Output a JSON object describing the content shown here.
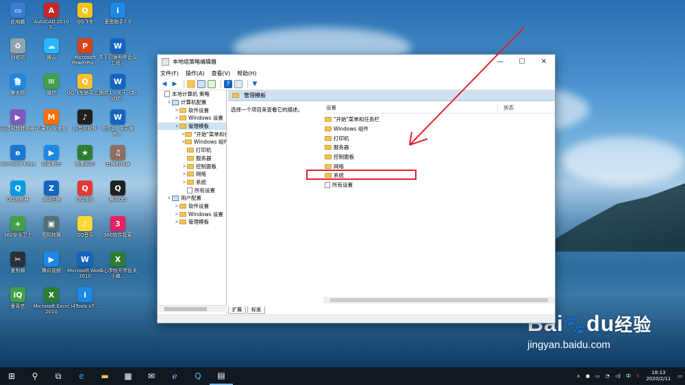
{
  "colors": {
    "taskbar": "#101820",
    "highlight": "#e0202a",
    "arrow": "#e0202a",
    "selection": "#cce4f7",
    "header_bg": "#cfe0f0"
  },
  "desktop": {
    "icons": [
      {
        "label": "此电脑",
        "color": "#3a7bd5",
        "glyph": "▭"
      },
      {
        "label": "AutoCAD 2010 - S...",
        "color": "#c62828",
        "glyph": "A"
      },
      {
        "label": "QQ飞车",
        "color": "#f5c518",
        "glyph": "Q"
      },
      {
        "label": "爱思助手7.0",
        "color": "#1e88e5",
        "glyph": "i"
      },
      {
        "label": "回收站",
        "color": "#90a4ae",
        "glyph": "♻"
      },
      {
        "label": "微云",
        "color": "#29b6f6",
        "glyph": "☁"
      },
      {
        "label": "Microsoft PowerPoi...",
        "color": "#d84315",
        "glyph": "P"
      },
      {
        "label": "关于印发明年会议上班...",
        "color": "#1565c0",
        "glyph": "W"
      },
      {
        "label": "鲁大师",
        "color": "#1e88e5",
        "glyph": "鲁"
      },
      {
        "label": "微信",
        "color": "#43a047",
        "glyph": "✉"
      },
      {
        "label": "QQ飞车助手工具",
        "color": "#fbc02d",
        "glyph": "Q"
      },
      {
        "label": "附件1：关于《新冠状...",
        "color": "#1565c0",
        "glyph": "W"
      },
      {
        "label": "迅捷视频转换器",
        "color": "#7e57c2",
        "glyph": "▶"
      },
      {
        "label": "芒果TV极速版",
        "color": "#ff6f00",
        "glyph": "M"
      },
      {
        "label": "抖音短视频",
        "color": "#212121",
        "glyph": "♪"
      },
      {
        "label": "附件2：关于发布...",
        "color": "#1565c0",
        "glyph": "W"
      },
      {
        "label": "Microsoft Edge",
        "color": "#1976d2",
        "glyph": "e"
      },
      {
        "label": "迅雷影音",
        "color": "#1e88e5",
        "glyph": "▶"
      },
      {
        "label": "收集网站",
        "color": "#2e7d32",
        "glyph": "★"
      },
      {
        "label": "音频剪辑器",
        "color": "#8d6e63",
        "glyph": "♫"
      },
      {
        "label": "QQ浏览器",
        "color": "#039be5",
        "glyph": "Q"
      },
      {
        "label": "360压缩",
        "color": "#1565c0",
        "glyph": "Z"
      },
      {
        "label": "QQ游戏",
        "color": "#e53935",
        "glyph": "Q"
      },
      {
        "label": "腾讯QQ",
        "color": "#212121",
        "glyph": "Q"
      },
      {
        "label": "360安全卫士",
        "color": "#43a047",
        "glyph": "+"
      },
      {
        "label": "图形转换",
        "color": "#546e7a",
        "glyph": "▣"
      },
      {
        "label": "QQ音乐",
        "color": "#fdd835",
        "glyph": "♪"
      },
      {
        "label": "360软件管家",
        "color": "#e91e63",
        "glyph": "3"
      },
      {
        "label": "爱剪辑",
        "color": "#263238",
        "glyph": "✂"
      },
      {
        "label": "腾讯视频",
        "color": "#1e88e5",
        "glyph": "▶"
      },
      {
        "label": "Microsoft Word 2010",
        "color": "#1565c0",
        "glyph": "W"
      },
      {
        "label": "中心学校开学前关于做...",
        "color": "#2e7d32",
        "glyph": "X"
      },
      {
        "label": "爱奇艺",
        "color": "#43a047",
        "glyph": "iQ"
      },
      {
        "label": "Microsoft Excel 2010",
        "color": "#2e7d32",
        "glyph": "X"
      },
      {
        "label": "i4Tools v7...",
        "color": "#1e88e5",
        "glyph": "i"
      }
    ]
  },
  "window": {
    "title": "本地组策略编辑器",
    "buttons": {
      "minimize": "—",
      "maximize": "☐",
      "close": "✕"
    },
    "menu": [
      "文件(F)",
      "操作(A)",
      "查看(V)",
      "帮助(H)"
    ],
    "tree": [
      {
        "label": "本地计算机 策略",
        "indent": 0,
        "icon": "doc",
        "twisty": ""
      },
      {
        "label": "计算机配置",
        "indent": 1,
        "icon": "pc",
        "twisty": "∨"
      },
      {
        "label": "软件设置",
        "indent": 2,
        "icon": "folder",
        "twisty": ">"
      },
      {
        "label": "Windows 设置",
        "indent": 2,
        "icon": "folder",
        "twisty": ">"
      },
      {
        "label": "管理模板",
        "indent": 2,
        "icon": "folder",
        "twisty": "∨",
        "selected": true
      },
      {
        "label": "\"开始\"菜单和任务栏",
        "indent": 3,
        "icon": "folder",
        "twisty": ">"
      },
      {
        "label": "Windows 组件",
        "indent": 3,
        "icon": "folder",
        "twisty": ">"
      },
      {
        "label": "打印机",
        "indent": 3,
        "icon": "folder",
        "twisty": ""
      },
      {
        "label": "服务器",
        "indent": 3,
        "icon": "folder",
        "twisty": ""
      },
      {
        "label": "控制面板",
        "indent": 3,
        "icon": "folder",
        "twisty": ">"
      },
      {
        "label": "网络",
        "indent": 3,
        "icon": "folder",
        "twisty": ">"
      },
      {
        "label": "系统",
        "indent": 3,
        "icon": "folder",
        "twisty": ">"
      },
      {
        "label": "所有设置",
        "indent": 3,
        "icon": "doc",
        "twisty": ""
      },
      {
        "label": "用户配置",
        "indent": 1,
        "icon": "pc",
        "twisty": "∨"
      },
      {
        "label": "软件设置",
        "indent": 2,
        "icon": "folder",
        "twisty": ">"
      },
      {
        "label": "Windows 设置",
        "indent": 2,
        "icon": "folder",
        "twisty": ">"
      },
      {
        "label": "管理模板",
        "indent": 2,
        "icon": "folder",
        "twisty": ">"
      }
    ],
    "right": {
      "header": "管理模板",
      "description": "选择一个项目来查看它的描述。",
      "col_setting": "设置",
      "col_state": "状态",
      "items": [
        {
          "label": "\"开始\"菜单和任务栏",
          "icon": "folder"
        },
        {
          "label": "Windows 组件",
          "icon": "folder"
        },
        {
          "label": "打印机",
          "icon": "folder"
        },
        {
          "label": "服务器",
          "icon": "folder"
        },
        {
          "label": "控制面板",
          "icon": "folder"
        },
        {
          "label": "网络",
          "icon": "folder"
        },
        {
          "label": "系统",
          "icon": "folder"
        },
        {
          "label": "所有设置",
          "icon": "doc"
        }
      ]
    },
    "tabs": [
      "扩展",
      "标准"
    ]
  },
  "taskbar": {
    "clock_time": "18:13",
    "clock_date": "2020/2/11",
    "ime": "中",
    "tray_up": "∧"
  },
  "watermark": {
    "brand": "Bai",
    "brand2": "du",
    "cn": "经验",
    "url": "jingyan.baidu.com"
  }
}
